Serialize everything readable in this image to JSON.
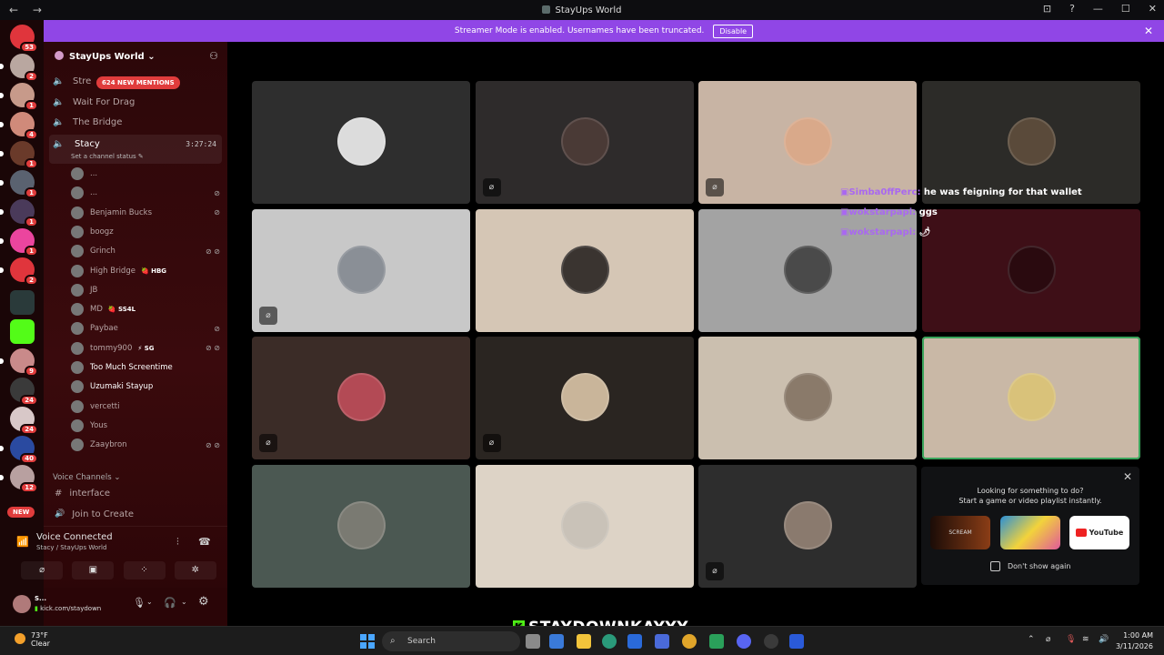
{
  "window": {
    "title": "StayUps World",
    "nav": "← →",
    "controls": [
      "⊡",
      "?",
      "—",
      "☐",
      "✕"
    ]
  },
  "banner": {
    "text": "Streamer Mode is enabled. Usernames have been truncated.",
    "button": "Disable"
  },
  "guilds": {
    "badges": [
      "53",
      "2",
      "1",
      "4",
      "1",
      "1",
      "1",
      "1",
      "2",
      "9",
      "24",
      "24",
      "40",
      "12"
    ],
    "new_label": "NEW"
  },
  "sidebar": {
    "server_name": "StayUps World ⌄",
    "mentions": "624 NEW MENTIONS",
    "channels": [
      "Stre",
      "Wait For Drag",
      "The Bridge"
    ],
    "active_channel": {
      "name": "Stacy",
      "time": "3:27:24",
      "status": "Set a channel status ✎"
    },
    "voice_users": [
      {
        "name": "...",
        "tag": "",
        "icons": ""
      },
      {
        "name": "...",
        "tag": "",
        "icons": "⊘"
      },
      {
        "name": "Benjamin Bucks",
        "tag": "",
        "icons": "⊘"
      },
      {
        "name": "boogz",
        "tag": "",
        "icons": ""
      },
      {
        "name": "Grinch",
        "tag": "",
        "icons": "⊘ ⊘"
      },
      {
        "name": "High Bridge",
        "tag": "🍓 HBG",
        "icons": ""
      },
      {
        "name": "JB",
        "tag": "",
        "icons": ""
      },
      {
        "name": "MD",
        "tag": "🍓 SS4L",
        "icons": ""
      },
      {
        "name": "Paybae",
        "tag": "",
        "icons": "⊘"
      },
      {
        "name": "tommy900",
        "tag": "⚡ SG",
        "icons": "⊘ ⊘"
      },
      {
        "name": "Too Much Screentime",
        "tag": "",
        "icons": ""
      },
      {
        "name": "Uzumaki Stayup",
        "tag": "",
        "icons": ""
      },
      {
        "name": "vercetti",
        "tag": "",
        "icons": ""
      },
      {
        "name": "Yous",
        "tag": "",
        "icons": ""
      },
      {
        "name": "Zaaybron",
        "tag": "",
        "icons": "⊘ ⊘"
      }
    ],
    "section_label": "Voice Channels ⌄",
    "extra_channels": [
      {
        "icon": "#",
        "name": "interface"
      },
      {
        "icon": "🔊",
        "name": "Join to Create"
      }
    ],
    "voice_connected": {
      "title": "Voice Connected",
      "subtitle": "Stacy / StayUps World"
    },
    "user_panel": {
      "name": "S...",
      "status": "kick.com/staydown"
    }
  },
  "grid": {
    "tiles": [
      {
        "bg": "#2e2e2e",
        "av": "#dcdcdc",
        "muted": false,
        "speaking": false
      },
      {
        "bg": "#2e2b2b",
        "av": "#4a3a36",
        "muted": true,
        "speaking": false
      },
      {
        "bg": "#c8b4a4",
        "av": "#d9a98a",
        "muted": true,
        "speaking": false
      },
      {
        "bg": "#2c2b28",
        "av": "#5a4a3a",
        "muted": false,
        "speaking": false
      },
      {
        "bg": "#c8c8c8",
        "av": "#8a8f96",
        "muted": true,
        "speaking": false
      },
      {
        "bg": "#d5c6b5",
        "av": "#3a3430",
        "muted": false,
        "speaking": false
      },
      {
        "bg": "#a3a3a3",
        "av": "#4a4a4a",
        "muted": false,
        "speaking": false
      },
      {
        "bg": "#3e0f17",
        "av": "#2a0a0f",
        "muted": false,
        "speaking": false
      },
      {
        "bg": "#3b2c27",
        "av": "#b34a55",
        "muted": true,
        "speaking": false
      },
      {
        "bg": "#2a2521",
        "av": "#c9b59a",
        "muted": true,
        "speaking": false
      },
      {
        "bg": "#cbbfaf",
        "av": "#8a7a6a",
        "muted": false,
        "speaking": false
      },
      {
        "bg": "#c9b8a6",
        "av": "#d9c27a",
        "muted": false,
        "speaking": true
      },
      {
        "bg": "#4b5852",
        "av": "#7a7a72",
        "muted": false,
        "speaking": false
      },
      {
        "bg": "#ddd3c6",
        "av": "#c9c2b8",
        "muted": false,
        "speaking": false
      },
      {
        "bg": "#2d2d2d",
        "av": "#8a7a6e",
        "muted": true,
        "speaking": false
      }
    ],
    "mute_glyph": "⌀"
  },
  "chat": [
    {
      "user": "Simba0ffPerc:",
      "msg": "he was feigning for that wallet"
    },
    {
      "user": "wokstarpapi:",
      "msg": "ggs"
    },
    {
      "user": "wokstarpapi:",
      "msg": "🌶"
    }
  ],
  "suggest": {
    "line1": "Looking for something to do?",
    "line2": "Start a game or video playlist instantly.",
    "card1": "SCREAM",
    "card3": "YouTube",
    "dont_show": "Don't show again"
  },
  "overlay": {
    "k": "K",
    "text": "STAYDOWNKAYYY"
  },
  "taskbar": {
    "temp": "73°F",
    "cond": "Clear",
    "search": "Search",
    "time": "1:00 AM",
    "date": "3/11/2026"
  }
}
